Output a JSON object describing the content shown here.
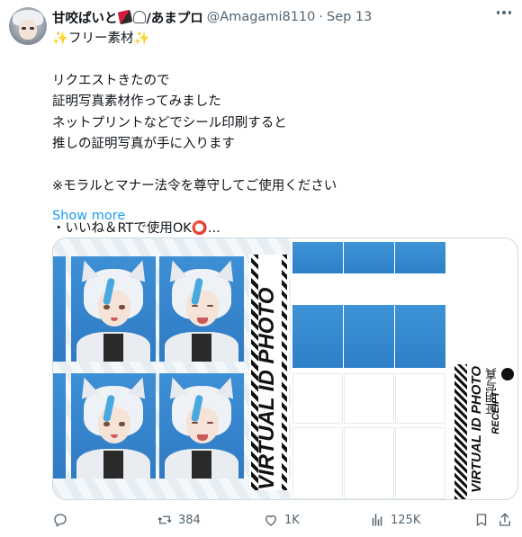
{
  "post": {
    "display_name": "甘咬ぱいと",
    "display_name_suffix": "/あまプロ",
    "handle": "@Amagami8110",
    "separator": "·",
    "date": "Sep 13",
    "title_line": "✨フリー素材✨",
    "body_lines": [
      "リクエストきたので",
      "証明写真素材作ってみました",
      "ネットプリントなどでシール印刷すると",
      "推しの証明写真が手に入ります",
      "",
      "※モラルとマナー法令を尊守してご使用ください",
      "",
      "・いいね＆RTで使用OK⭕..."
    ],
    "show_more_label": "Show more"
  },
  "media": {
    "banner_text": "VIRTUAL ID PHOTO",
    "receipt_title": "VIRTUAL ID PHOTO",
    "receipt_sub": "RECEIPT",
    "receipt_jp": "証明写真"
  },
  "actions": {
    "reply_count": "",
    "repost_count": "384",
    "like_count": "1K",
    "views_count": "125K"
  },
  "icons": {
    "reply": "reply-icon",
    "repost": "repost-icon",
    "like": "like-icon",
    "views": "views-icon",
    "bookmark": "bookmark-icon",
    "share": "share-icon",
    "more": "more-icon"
  },
  "colors": {
    "link": "#1d9bf0",
    "muted": "#536471",
    "text": "#0f1419",
    "photo_bg": "#3d8fd6"
  }
}
